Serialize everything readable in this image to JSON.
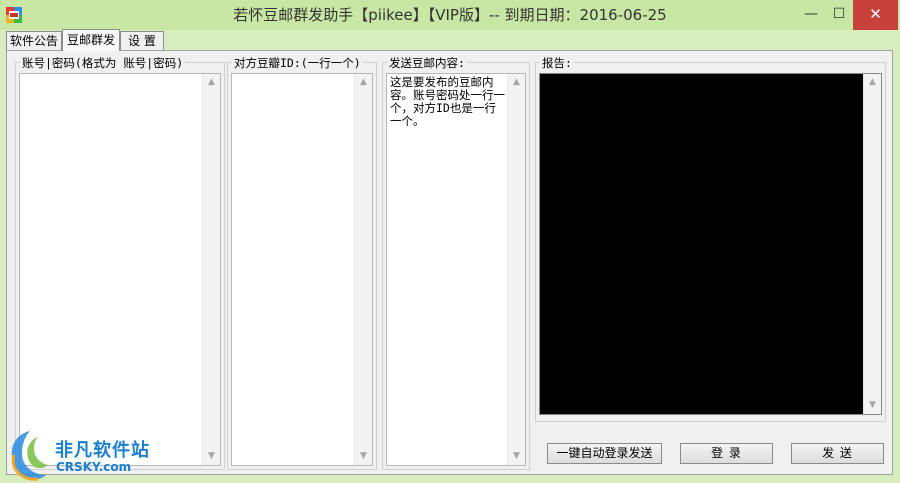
{
  "window": {
    "title": "若怀豆邮群发助手【piikee】【VIP版】-- 到期日期：2016-06-25",
    "minimize_glyph": "—",
    "maximize_glyph": "☐",
    "close_glyph": "✕"
  },
  "tabs": [
    {
      "label": "软件公告"
    },
    {
      "label": "豆邮群发"
    },
    {
      "label": "设 置"
    }
  ],
  "active_tab": "豆邮群发",
  "groups": {
    "accounts": {
      "label": "账号|密码(格式为 账号|密码)",
      "value": ""
    },
    "targets": {
      "label": "对方豆瓣ID:(一行一个)",
      "value": ""
    },
    "message": {
      "label": "发送豆邮内容:",
      "value": "这是要发布的豆邮内容。账号密码处一行一个，对方ID也是一行一个。"
    },
    "report": {
      "label": "报告:"
    }
  },
  "buttons": {
    "auto_login_send": "一键自动登录发送",
    "login": "登 录",
    "send": "发 送"
  },
  "watermark": {
    "cn": "非凡软件站",
    "en": "CRSKY.com"
  },
  "colors": {
    "window_bg": "#d8edbd",
    "panel_bg": "#f0f0f0",
    "close_red": "#c7403a",
    "report_bg": "#000000",
    "watermark_blue": "#1a7fd1"
  }
}
